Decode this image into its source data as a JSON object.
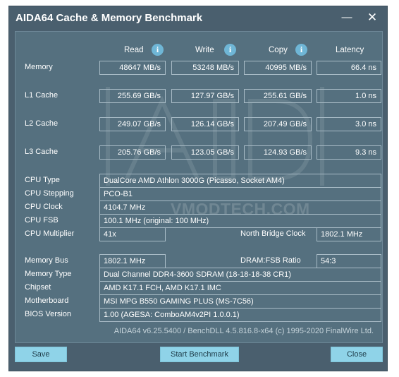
{
  "window": {
    "title": "AIDA64 Cache & Memory Benchmark",
    "minimize_glyph": "—",
    "close_glyph": "✕"
  },
  "columns": {
    "read": "Read",
    "write": "Write",
    "copy": "Copy",
    "latency": "Latency",
    "info_glyph": "i"
  },
  "rows": {
    "memory": {
      "label": "Memory",
      "read": "48647 MB/s",
      "write": "53248 MB/s",
      "copy": "40995 MB/s",
      "latency": "66.4 ns"
    },
    "l1": {
      "label": "L1 Cache",
      "read": "255.69 GB/s",
      "write": "127.97 GB/s",
      "copy": "255.61 GB/s",
      "latency": "1.0 ns"
    },
    "l2": {
      "label": "L2 Cache",
      "read": "249.07 GB/s",
      "write": "126.14 GB/s",
      "copy": "207.49 GB/s",
      "latency": "3.0 ns"
    },
    "l3": {
      "label": "L3 Cache",
      "read": "205.76 GB/s",
      "write": "123.05 GB/s",
      "copy": "124.93 GB/s",
      "latency": "9.3 ns"
    }
  },
  "cpu": {
    "type_label": "CPU Type",
    "type_value": "DualCore AMD Athlon 3000G  (Picasso, Socket AM4)",
    "stepping_label": "CPU Stepping",
    "stepping_value": "PCO-B1",
    "clock_label": "CPU Clock",
    "clock_value": "4104.7 MHz",
    "fsb_label": "CPU FSB",
    "fsb_value": "100.1 MHz  (original: 100 MHz)",
    "multiplier_label": "CPU Multiplier",
    "multiplier_value": "41x",
    "nb_clock_label": "North Bridge Clock",
    "nb_clock_value": "1802.1 MHz"
  },
  "memory_info": {
    "bus_label": "Memory Bus",
    "bus_value": "1802.1 MHz",
    "ratio_label": "DRAM:FSB Ratio",
    "ratio_value": "54:3",
    "type_label": "Memory Type",
    "type_value": "Dual Channel DDR4-3600 SDRAM  (18-18-18-38 CR1)",
    "chipset_label": "Chipset",
    "chipset_value": "AMD K17.1 FCH, AMD K17.1 IMC",
    "motherboard_label": "Motherboard",
    "motherboard_value": "MSI MPG B550 GAMING PLUS (MS-7C56)",
    "bios_label": "BIOS Version",
    "bios_value": "1.00  (AGESA: ComboAM4v2PI 1.0.0.1)"
  },
  "watermark": "VMODTECH.COM",
  "footer": "AIDA64 v6.25.5400 / BenchDLL 4.5.816.8-x64  (c) 1995-2020 FinalWire Ltd.",
  "buttons": {
    "save": "Save",
    "start": "Start Benchmark",
    "close": "Close"
  },
  "colors": {
    "window_bg": "#4a5f6e",
    "panel_bg": "#55707f",
    "button_bg": "#8fd3e8",
    "info_icon": "#6fb6d6"
  }
}
